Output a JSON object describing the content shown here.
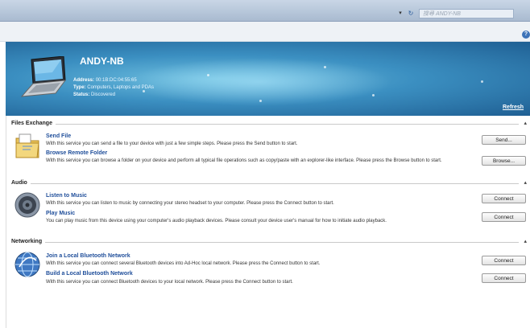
{
  "topbar": {
    "back_glyph": "▾",
    "nav_glyph": "↻",
    "search_placeholder": "搜尋 ANDY-NB"
  },
  "help_glyph": "?",
  "device": {
    "name": "ANDY-NB",
    "address_label": "Address:",
    "address": "00:1B:DC:04:55:65",
    "type_label": "Type:",
    "type": "Computers, Laptops and PDAs",
    "status_label": "Status:",
    "status": "Discovered",
    "refresh_label": "Refresh"
  },
  "sections": {
    "files": {
      "title": "Files Exchange",
      "send_title": "Send File",
      "send_desc": "With this service you can send a file to your device with just a few simple steps. Please press the Send button to start.",
      "send_btn": "Send...",
      "browse_title": "Browse Remote Folder",
      "browse_desc": "With this service you can browse a folder on your device and perform all typical file operations such as copy/paste with an explorer-like interface. Please press the Browse button to start.",
      "browse_btn": "Browse..."
    },
    "audio": {
      "title": "Audio",
      "listen_title": "Listen to Music",
      "listen_desc": "With this service you can listen to music by connecting your stereo headset to your computer. Please press the Connect button to start.",
      "listen_btn": "Connect",
      "play_title": "Play Music",
      "play_desc": "You can play music from this device using your computer's audio playback devices. Please consult your device user's manual for how to initiate audio playback.",
      "play_btn": "Connect"
    },
    "networking": {
      "title": "Networking",
      "join_title": "Join a Local Bluetooth Network",
      "join_desc": "With this service you can connect several Bluetooth devices into Ad-Hoc local network. Please press the Connect button to start.",
      "join_btn": "Connect",
      "build_title": "Build a Local Bluetooth Network",
      "build_desc": "With this service you can connect Bluetooth devices to your local network. Please press the Connect button to start.",
      "build_btn": "Connect"
    }
  },
  "collapse_glyph": "▴"
}
